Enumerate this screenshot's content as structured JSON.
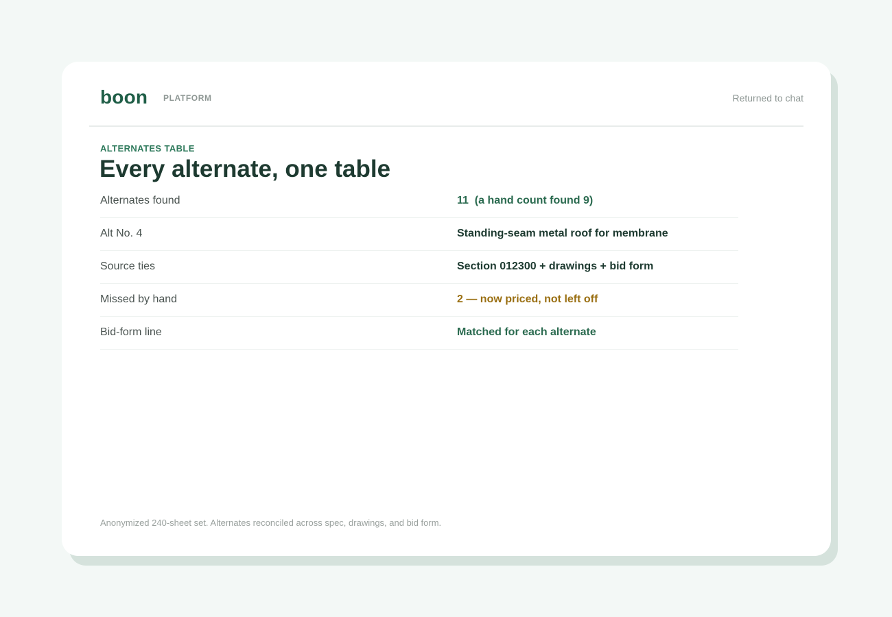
{
  "brand": "boon",
  "platform_label": "PLATFORM",
  "status_text": "Returned to chat",
  "eyebrow": "ALTERNATES TABLE",
  "title": "Every alternate, one table",
  "rows": [
    {
      "label": "Alternates found",
      "value": "11  (a hand count found 9)",
      "tone": "green"
    },
    {
      "label": "Alt No. 4",
      "value": "Standing-seam metal roof for membrane",
      "tone": "dark"
    },
    {
      "label": "Source ties",
      "value": "Section 012300 + drawings + bid form",
      "tone": "dark"
    },
    {
      "label": "Missed by hand",
      "value": "2 — now priced, not left off",
      "tone": "amber"
    },
    {
      "label": "Bid-form line",
      "value": "Matched for each alternate",
      "tone": "green"
    }
  ],
  "footer_note": "Anonymized 240-sheet set. Alternates reconciled across spec, drawings, and bid form.",
  "colors": {
    "background": "#f3f8f6",
    "brand": "#1f5e47",
    "accent_green": "#2a6a4f",
    "accent_amber": "#9a6f12",
    "text_dark": "#1d3a30"
  }
}
